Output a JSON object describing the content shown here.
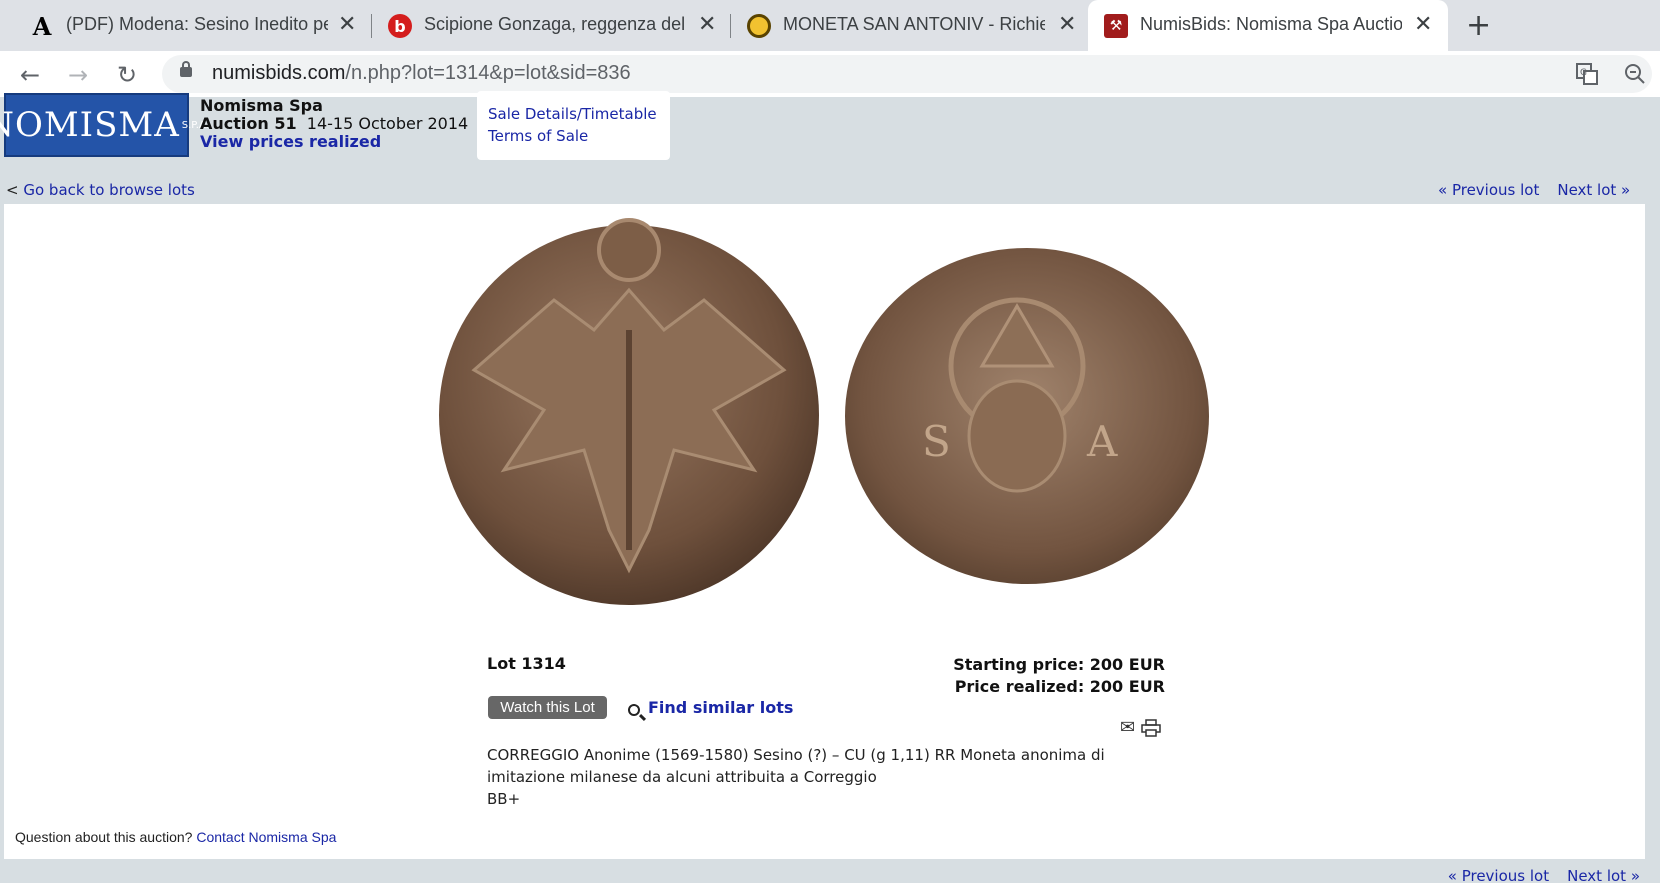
{
  "tabs": [
    {
      "title": "(PDF) Modena: Sesino Inedito pe",
      "favicon": "A"
    },
    {
      "title": "Scipione Gonzaga, reggenza dell",
      "favicon": "b"
    },
    {
      "title": "MONETA SAN ANTONIV - Richies",
      "favicon": "coin"
    },
    {
      "title": "NumisBids: Nomisma Spa Auctio",
      "favicon": "gavel"
    }
  ],
  "toolbar": {
    "url_host": "numisbids.com",
    "url_path": "/n.php?lot=1314&p=lot&sid=836"
  },
  "header": {
    "logo_text": "NOMISMA",
    "logo_sub": "S.P.A.",
    "company": "Nomisma Spa",
    "auction_label": "Auction 51",
    "auction_dates": "14-15 October 2014",
    "prices_link": "View prices realized",
    "sale_details": "Sale Details/Timetable",
    "terms": "Terms of Sale"
  },
  "nav": {
    "back_prefix": "<",
    "back": "Go back to browse lots",
    "previous": "« Previous lot",
    "next": "Next lot »"
  },
  "lot": {
    "number": "Lot 1314",
    "starting_price": "Starting price: 200 EUR",
    "price_realized": "Price realized: 200 EUR",
    "watch": "Watch this Lot",
    "find_similar": "Find similar lots",
    "description_line1": "CORREGGIO Anonime (1569-1580) Sesino (?) – CU (g 1,11) RR Moneta anonima di imitazione milanese da alcuni attribuita a Correggio",
    "grade": "BB+"
  },
  "footer": {
    "question": "Question about this auction?",
    "contact": "Contact Nomisma Spa"
  },
  "colors": {
    "logo_blue": "#2454a8",
    "link_blue": "#1a27a6",
    "page_bg": "#d7dee2",
    "coin_bronze": "#7a5a44"
  }
}
